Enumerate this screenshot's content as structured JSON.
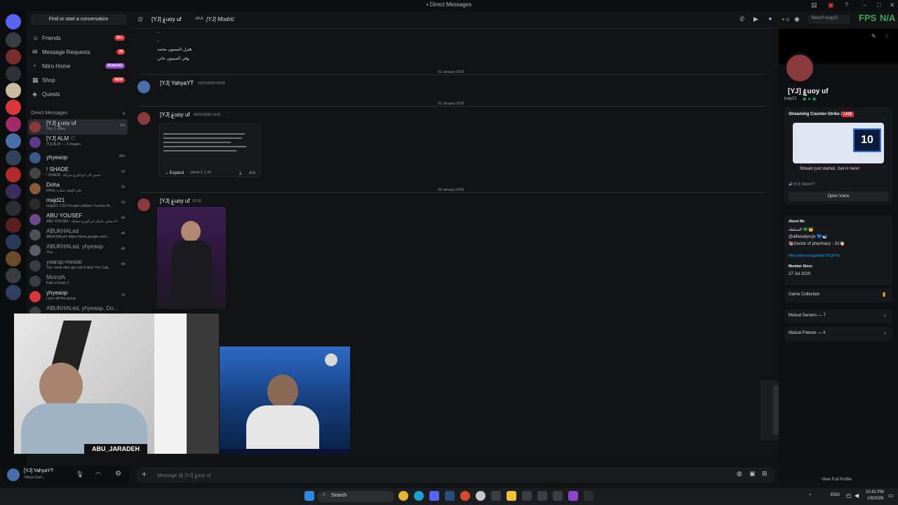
{
  "window": {
    "title": "Direct Messages"
  },
  "dm_sidebar": {
    "find_label": "Find or start a conversation",
    "nav": [
      {
        "label": "Friends",
        "badge": "1K+"
      },
      {
        "label": "Message Requests",
        "badge": "28"
      },
      {
        "label": "Nitro Home",
        "badge": "REWARD"
      },
      {
        "label": "Shop",
        "badge": "NEW"
      },
      {
        "label": "Quests",
        "badge": ""
      }
    ],
    "section_label": "Direct Messages",
    "dms": [
      {
        "name": "[YJ] ۼuoy uf",
        "sub": "You: 1 video",
        "time": "1m"
      },
      {
        "name": "[YJ] ALM ♡",
        "sub": "[YJ] ALM ♡: 3 images",
        "time": ""
      },
      {
        "name": "yhyeaop",
        "sub": "",
        "time": "20h"
      },
      {
        "name": "! SHADE",
        "sub": "! SHADE: حبيبي الى ابو الورع شرايك",
        "time": "1d"
      },
      {
        "name": "Doha",
        "sub": "Doha: خلي الشلة سكره",
        "time": "1d"
      },
      {
        "name": "majd21",
        "sub": "majd21: CS2 Private Lobbies: Custom M...",
        "time": "1d"
      },
      {
        "name": "ABU YOUSEF",
        "sub": "ABU YOUSEF: انا بحكي عليكم ابو الورع عشانك",
        "time": "4d"
      },
      {
        "name": "ABUKHALed",
        "sub": "ABUKHALed: https://drive.google.com/...",
        "time": "4d"
      },
      {
        "name": "ABUKHALed, yhyeaop",
        "sub": "You: ..",
        "time": "4d"
      },
      {
        "name": "yaarup-meslat",
        "sub": "You: tomb rider gta call of duty The Calli...",
        "time": "4d"
      },
      {
        "name": "MirindA",
        "sub": "Path of Exile 2",
        "time": ""
      },
      {
        "name": "yhyeaop",
        "sub": "Leen left the group.",
        "time": "7d"
      },
      {
        "name": "ABUKHALed, yhyeaop, Do...",
        "sub": "",
        "time": ""
      }
    ]
  },
  "user_panel": {
    "name": "[YJ] YahyaYT",
    "status": "Yahya Gam..."
  },
  "chat_header": {
    "name": "[YJ] ۼuoy uf",
    "aka_label": "AKA",
    "aka_value": "[YJ] Modrić",
    "search_placeholder": "Search luay21"
  },
  "overlay": {
    "fps": "FPS",
    "na": "N/A",
    "streamer_name": "ABU_JARADEH"
  },
  "messages": {
    "top_lines": [
      "..",
      "..",
      "هتزل الميمون محمد",
      "وفي الميمون حاتن"
    ],
    "dates": [
      "01 January 2026",
      "02 January 2026",
      "09 January 2026"
    ],
    "m1": {
      "author": "[YJ] YahyaYT",
      "time": "01/01/2026 03:05",
      "text": "."
    },
    "m2": {
      "author": "[YJ] ۼuoy uf",
      "time": "02/01/2026 14:01",
      "expand": "Expand",
      "file": "yahya 2_1.txt"
    },
    "m3": {
      "author": "[YJ] ۼuoy uf",
      "time": "22:33"
    }
  },
  "composer": {
    "placeholder": "Message @ [YJ] ۼuoy uf"
  },
  "profile": {
    "name": "[YJ] ۼuoy uf",
    "username": "luay21",
    "stream_label": "Streaming Counter-Strike 2",
    "live": "LIVE",
    "stream_text": "Stream just started. Get in here!",
    "voice_user": "[YJ] YahyaYT",
    "open_voice": "Open Voice",
    "about_title": "About Me",
    "about_lines": [
      "السلطة 🇸🇦👑",
      "@alfaisalyscjo 💙🐋",
      "📚Doctor of pharmacy - JU👋🏻"
    ],
    "about_link": "https://discord.gg/eBxE7WQ5Ym",
    "member_since_title": "Member Since",
    "member_since": "27 Jul 2020",
    "game_collection": "Game Collection",
    "mutual_servers": "Mutual Servers — 7",
    "mutual_friends": "Mutual Friends — 4",
    "full_profile": "View Full Profile",
    "score": "10"
  },
  "taskbar": {
    "search": "Search",
    "lang": "ENG",
    "time": "10:42 PM",
    "date": "1/9/2026"
  },
  "colors": {
    "accent": "#5865f2",
    "live": "#da373c",
    "green": "#23a559",
    "fps": "#3ba55d"
  }
}
